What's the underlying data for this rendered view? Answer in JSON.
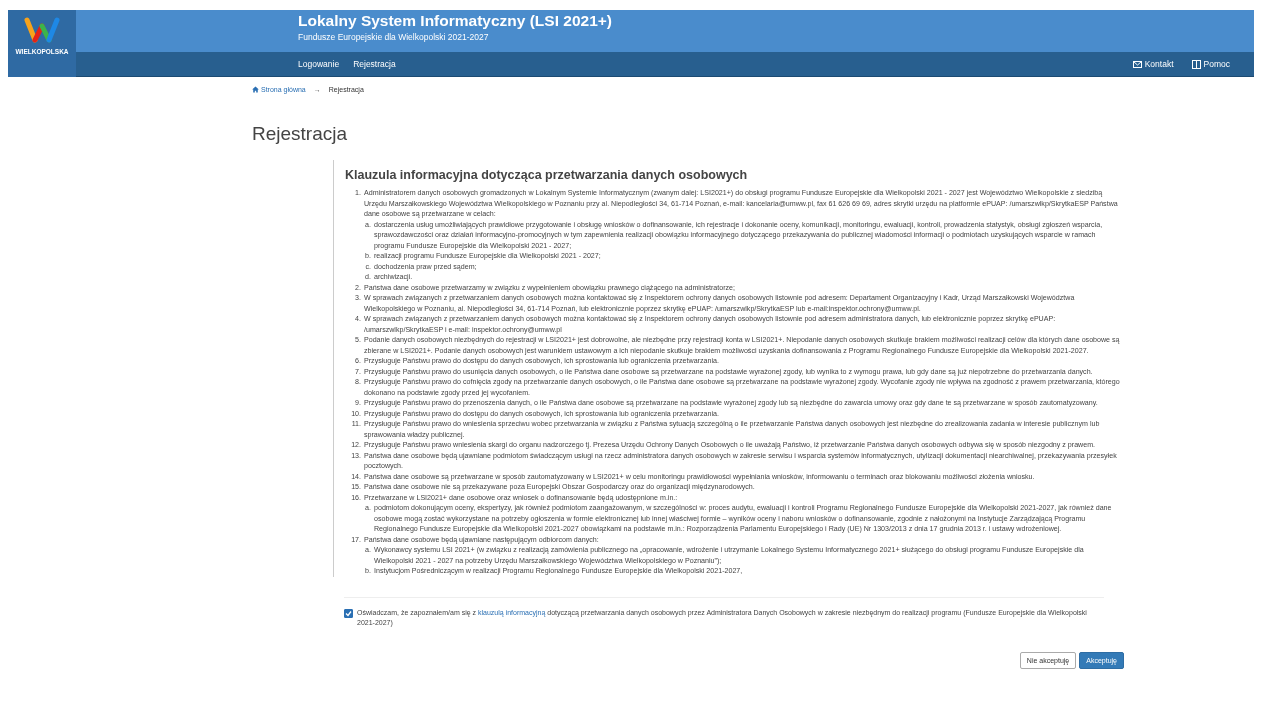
{
  "header": {
    "logo_text": "WIELKOPOLSKA",
    "title": "Lokalny System Informatyczny (LSI 2021+)",
    "subtitle": "Fundusze Europejskie dla Wielkopolski 2021-2027"
  },
  "nav": {
    "items": [
      {
        "label": "Logowanie"
      },
      {
        "label": "Rejestracja"
      }
    ],
    "right": [
      {
        "label": "Kontakt",
        "kind": "mail"
      },
      {
        "label": "Pomoc",
        "kind": "book"
      }
    ]
  },
  "breadcrumb": [
    {
      "label": "Strona główna",
      "kind": "link"
    },
    {
      "label": "Rejestracja",
      "kind": "current"
    }
  ],
  "breadcrumb_separator": "→",
  "page_title": "Rejestracja",
  "clause": {
    "heading": "Klauzula informacyjna dotycząca przetwarzania danych osobowych",
    "items": [
      {
        "number": "1.",
        "text": "Administratorem danych osobowych gromadzonych w Lokalnym Systemie Informatycznym (zwanym dalej: LSI2021+) do obsługi programu Fundusze Europejskie dla Wielkopolski 2021 - 2027 jest Województwo Wielkopolskie z siedzibą Urzędu Marszałkowskiego Województwa Wielkopolskiego w Poznaniu przy al. Niepodległości 34, 61-714 Poznań, e-mail: kancelaria@umww.pl, fax 61 626 69 69, adres skrytki urzędu na platformie ePUAP: /umarszwlkp/SkrytkaESP Państwa dane osobowe są przetwarzane w celach:",
        "children": [
          {
            "number": "a.",
            "text": "dostarczenia usług umożliwiających prawidłowe przygotowanie i obsługę wniosków o dofinansowanie, ich rejestracje i dokonanie oceny, komunikacji, monitoringu, ewaluacji, kontroli, prowadzenia statystyk, obsługi zgłoszeń wsparcia, sprawozdawczości oraz działań informacyjno-promocyjnych w tym zapewnienia realizacji obowiązku informacyjnego dotyczącego przekazywania do publicznej wiadomości informacji o podmiotach uzyskujących wsparcie w ramach programu Fundusze Europejskie dla Wielkopolski 2021 - 2027;"
          },
          {
            "number": "b.",
            "text": "realizacji programu Fundusze Europejskie dla Wielkopolski 2021 - 2027;"
          },
          {
            "number": "c.",
            "text": "dochodzenia praw przed sądem;"
          },
          {
            "number": "d.",
            "text": "archiwizacji."
          }
        ]
      },
      {
        "number": "2.",
        "text": "Państwa dane osobowe przetwarzamy w związku z wypełnieniem obowiązku prawnego ciążącego na administratorze;"
      },
      {
        "number": "3.",
        "text": "W sprawach związanych z przetwarzaniem danych osobowych można kontaktować się z Inspektorem ochrony danych osobowych listownie pod adresem: Departament Organizacyjny i Kadr, Urząd Marszałkowski Województwa Wielkopolskiego w Poznaniu, al. Niepodległości 34, 61-714 Poznań, lub elektronicznie poprzez skrytkę ePUAP: /umarszwlkp/SkrytkaESP lub e-mail:inspektor.ochrony@umww.pl."
      },
      {
        "number": "4.",
        "text": "W sprawach związanych z przetwarzaniem danych osobowych można kontaktować się z Inspektorem ochrony danych osobowych listownie pod adresem administratora danych, lub elektronicznie poprzez skrytkę ePUAP: /umarszwlkp/SkrytkaESP i e-mail: inspektor.ochrony@umww.pl"
      },
      {
        "number": "5.",
        "text": "Podanie danych osobowych niezbędnych do rejestracji w LSI2021+ jest dobrowolne, ale niezbędne przy rejestracji konta w LSI2021+. Niepodanie danych osobowych skutkuje brakiem możliwości realizacji celów dla których dane osobowe są zbierane w LSI2021+. Podanie danych osobowych jest warunkiem ustawowym a ich niepodanie skutkuje brakiem możliwości uzyskania dofinansowania z Programu Regionalnego Fundusze Europejskie dla Wielkopolski 2021-2027."
      },
      {
        "number": "6.",
        "text": "Przysługuje Państwu prawo do dostępu do danych osobowych, ich sprostowania lub ograniczenia przetwarzania."
      },
      {
        "number": "7.",
        "text": "Przysługuje Państwu prawo do usunięcia danych osobowych, o ile Państwa dane osobowe są przetwarzane na podstawie wyrażonej zgody, lub wynika to z wymogu prawa, lub gdy dane są już niepotrzebne do przetwarzania danych."
      },
      {
        "number": "8.",
        "text": "Przysługuje Państwu prawo do cofnięcia zgody na przetwarzanie danych osobowych, o ile Państwa dane osobowe są przetwarzane na podstawie wyrażonej zgody. Wycofanie zgody nie wpływa na zgodność z prawem przetwarzania, którego dokonano na podstawie zgody przed jej wycofaniem."
      },
      {
        "number": "9.",
        "text": "Przysługuje Państwu prawo do przenoszenia danych, o ile Państwa dane osobowe są przetwarzane na podstawie wyrażonej zgody lub są niezbędne do zawarcia umowy oraz gdy dane te są przetwarzane w sposób zautomatyzowany."
      },
      {
        "number": "10.",
        "text": "Przysługuje Państwu prawo do dostępu do danych osobowych, ich sprostowania lub ograniczenia przetwarzania."
      },
      {
        "number": "11.",
        "text": "Przysługuje Państwu prawo do wniesienia sprzeciwu wobec przetwarzania w związku z Państwa sytuacją szczególną o ile przetwarzanie Państwa danych osobowych jest niezbędne do zrealizowania zadania w interesie publicznym lub sprawowania władzy publicznej."
      },
      {
        "number": "12.",
        "text": "Przysługuje Państwu prawo wniesienia skargi do organu nadzorczego tj. Prezesa Urzędu Ochrony Danych Osobowych o ile uważają Państwo, iż przetwarzanie Państwa danych osobowych odbywa się w sposób niezgodny z prawem."
      },
      {
        "number": "13.",
        "text": "Państwa dane osobowe będą ujawniane podmiotom świadczącym usługi na rzecz administratora danych osobowych w zakresie serwisu i wsparcia systemów informatycznych, utylizacji dokumentacji niearchiwalnej, przekazywania przesyłek pocztowych."
      },
      {
        "number": "14.",
        "text": "Państwa dane osobowe są przetwarzane w sposób zautomatyzowany w LSI2021+ w celu monitoringu prawidłowości wypełniania wniosków, informowaniu o terminach oraz blokowaniu możliwości złożenia wniosku."
      },
      {
        "number": "15.",
        "text": "Państwa dane osobowe nie są przekazywane poza Europejski Obszar Gospodarczy oraz do organizacji międzynarodowych."
      },
      {
        "number": "16.",
        "text": "Przetwarzane w LSI2021+ dane osobowe oraz wniosek o dofinansowanie będą udostępnione m.in.:",
        "children": [
          {
            "number": "a.",
            "text": "podmiotom dokonującym oceny, ekspertyzy, jak również podmiotom zaangażowanym, w szczególności w: proces audytu, ewaluacji i kontroli Programu Regionalnego Fundusze Europejskie dla Wielkopolski 2021-2027, jak również dane osobowe mogą zostać wykorzystane na potrzeby ogłoszenia w formie elektronicznej lub innej właściwej formie – wyników oceny i naboru wniosków o dofinansowanie, zgodnie z nałożonymi na Instytucje Zarządzającą Programu Regionalnego Fundusze Europejskie dla Wielkopolski 2021-2027 obowiązkami na podstawie m.in.: Rozporządzenia Parlamentu Europejskiego i Rady (UE) Nr 1303/2013 z dnia 17 grudnia 2013 r. i ustawy wdrożeniowej."
          }
        ]
      },
      {
        "number": "17.",
        "text": "Państwa dane osobowe będą ujawniane następującym odbiorcom danych:",
        "children": [
          {
            "number": "a.",
            "text": "Wykonawcy systemu LSI 2021+ (w związku z realizacją zamówienia publicznego na „opracowanie, wdrożenie i utrzymanie Lokalnego Systemu Informatycznego 2021+ służącego do obsługi programu Fundusze Europejskie dla Wielkopolski 2021 - 2027 na potrzeby Urzędu Marszałkowskiego Województwa Wielkopolskiego w Poznaniu”);"
          },
          {
            "number": "b.",
            "text": "Instytucjom Pośredniczącym w realizacji Programu Regionalnego Fundusze Europejskie dla Wielkopolski 2021-2027,"
          }
        ]
      }
    ]
  },
  "consent": {
    "checked": true,
    "text_before": "Oświadczam, że zapoznałem/am się z",
    "link": "klauzulą informacyjną",
    "text_after": "dotyczącą przetwarzania danych osobowych przez Administratora Danych Osobowych w zakresie niezbędnym do realizacji programu (Fundusze Europejskie dla Wielkopolski 2021-2027)"
  },
  "buttons": [
    {
      "label": "Nie akceptuję",
      "kind": "default"
    },
    {
      "label": "Akceptuję",
      "kind": "primary"
    }
  ]
}
